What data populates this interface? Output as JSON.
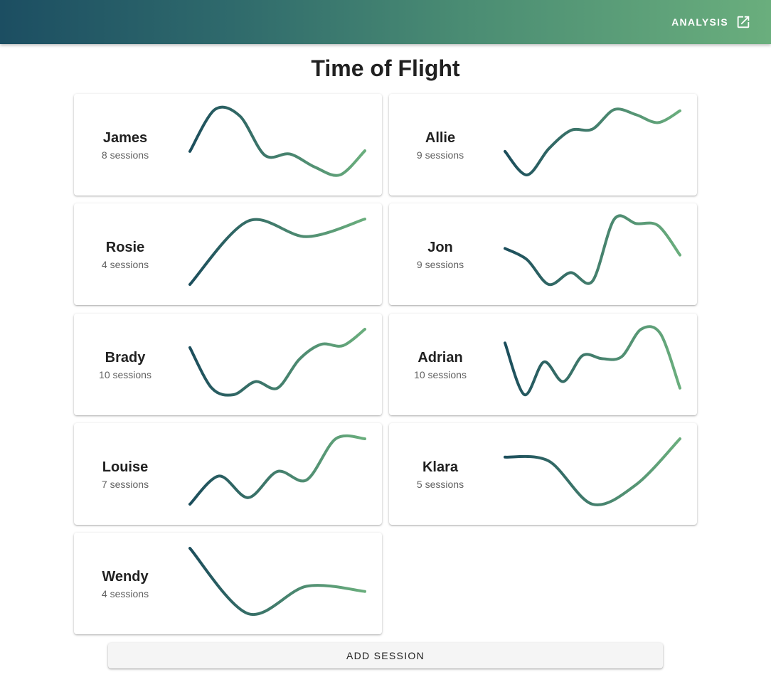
{
  "header": {
    "analysis_label": "ANALYSIS",
    "gradient_start": "#1c4e62",
    "gradient_end": "#6aae7d"
  },
  "page": {
    "title": "Time of Flight"
  },
  "line_colors": {
    "start": "#1c4e5c",
    "end": "#6aae7d"
  },
  "chart_data": [
    {
      "type": "line",
      "name": "James",
      "sessions_label": "8 sessions",
      "values": [
        0.36,
        1.0,
        0.9,
        0.3,
        0.32,
        0.12,
        0.0,
        0.37
      ]
    },
    {
      "type": "line",
      "name": "Allie",
      "sessions_label": "9 sessions",
      "values": [
        0.36,
        0.0,
        0.4,
        0.68,
        0.7,
        1.0,
        0.92,
        0.8,
        0.98
      ]
    },
    {
      "type": "line",
      "name": "Rosie",
      "sessions_label": "4 sessions",
      "values": [
        0.0,
        0.97,
        0.73,
        1.0
      ]
    },
    {
      "type": "line",
      "name": "Jon",
      "sessions_label": "9 sessions",
      "values": [
        0.55,
        0.38,
        0.0,
        0.18,
        0.05,
        1.0,
        0.93,
        0.9,
        0.45
      ]
    },
    {
      "type": "line",
      "name": "Brady",
      "sessions_label": "10 sessions",
      "values": [
        0.72,
        0.1,
        0.0,
        0.2,
        0.1,
        0.54,
        0.77,
        0.75,
        1.0
      ]
    },
    {
      "type": "line",
      "name": "Adrian",
      "sessions_label": "10 sessions",
      "values": [
        0.79,
        0.0,
        0.5,
        0.2,
        0.6,
        0.55,
        0.58,
        1.0,
        0.93,
        0.1
      ]
    },
    {
      "type": "line",
      "name": "Louise",
      "sessions_label": "7 sessions",
      "values": [
        0.0,
        0.43,
        0.1,
        0.5,
        0.37,
        1.0,
        1.0
      ]
    },
    {
      "type": "line",
      "name": "Klara",
      "sessions_label": "5 sessions",
      "values": [
        0.72,
        0.66,
        0.0,
        0.3,
        1.0
      ]
    },
    {
      "type": "line",
      "name": "Wendy",
      "sessions_label": "4 sessions",
      "values": [
        1.0,
        0.0,
        0.42,
        0.34
      ]
    }
  ],
  "actions": {
    "add_session_label": "ADD SESSION"
  }
}
